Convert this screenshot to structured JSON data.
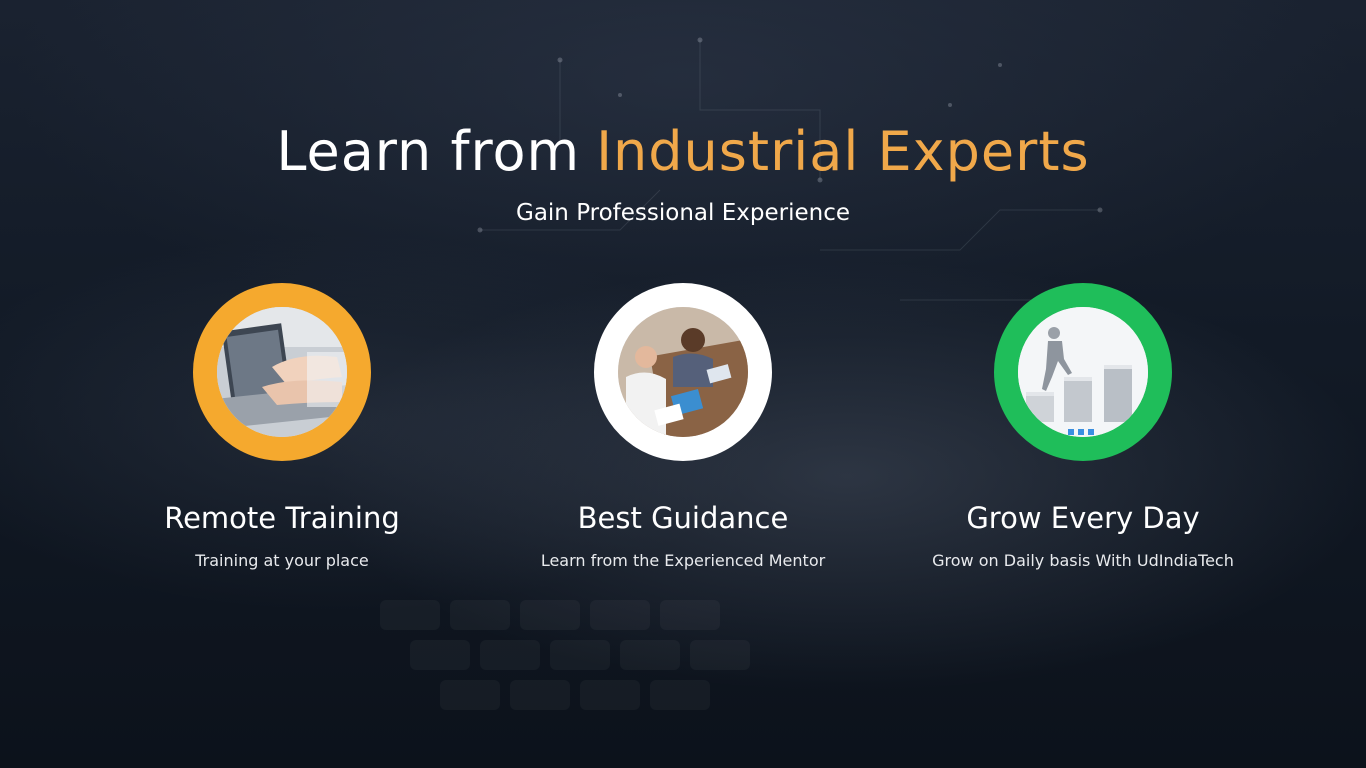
{
  "heading": {
    "part1": "Learn from",
    "part2": "Industrial Experts"
  },
  "subtitle": "Gain Professional Experience",
  "features": [
    {
      "title": "Remote Training",
      "description": "Training at your place",
      "ring_color": "#f5a92e",
      "image": "typing-laptop-photo"
    },
    {
      "title": "Best Guidance",
      "description": "Learn from the Experienced Mentor",
      "ring_color": "#ffffff",
      "image": "mentoring-desk-photo"
    },
    {
      "title": "Grow Every Day",
      "description": "Grow on Daily basis With UdIndiaTech",
      "ring_color": "#1fbe5a",
      "image": "climbing-steps-photo"
    }
  ],
  "colors": {
    "accent": "#f0a84a",
    "background": "#0f1520"
  }
}
